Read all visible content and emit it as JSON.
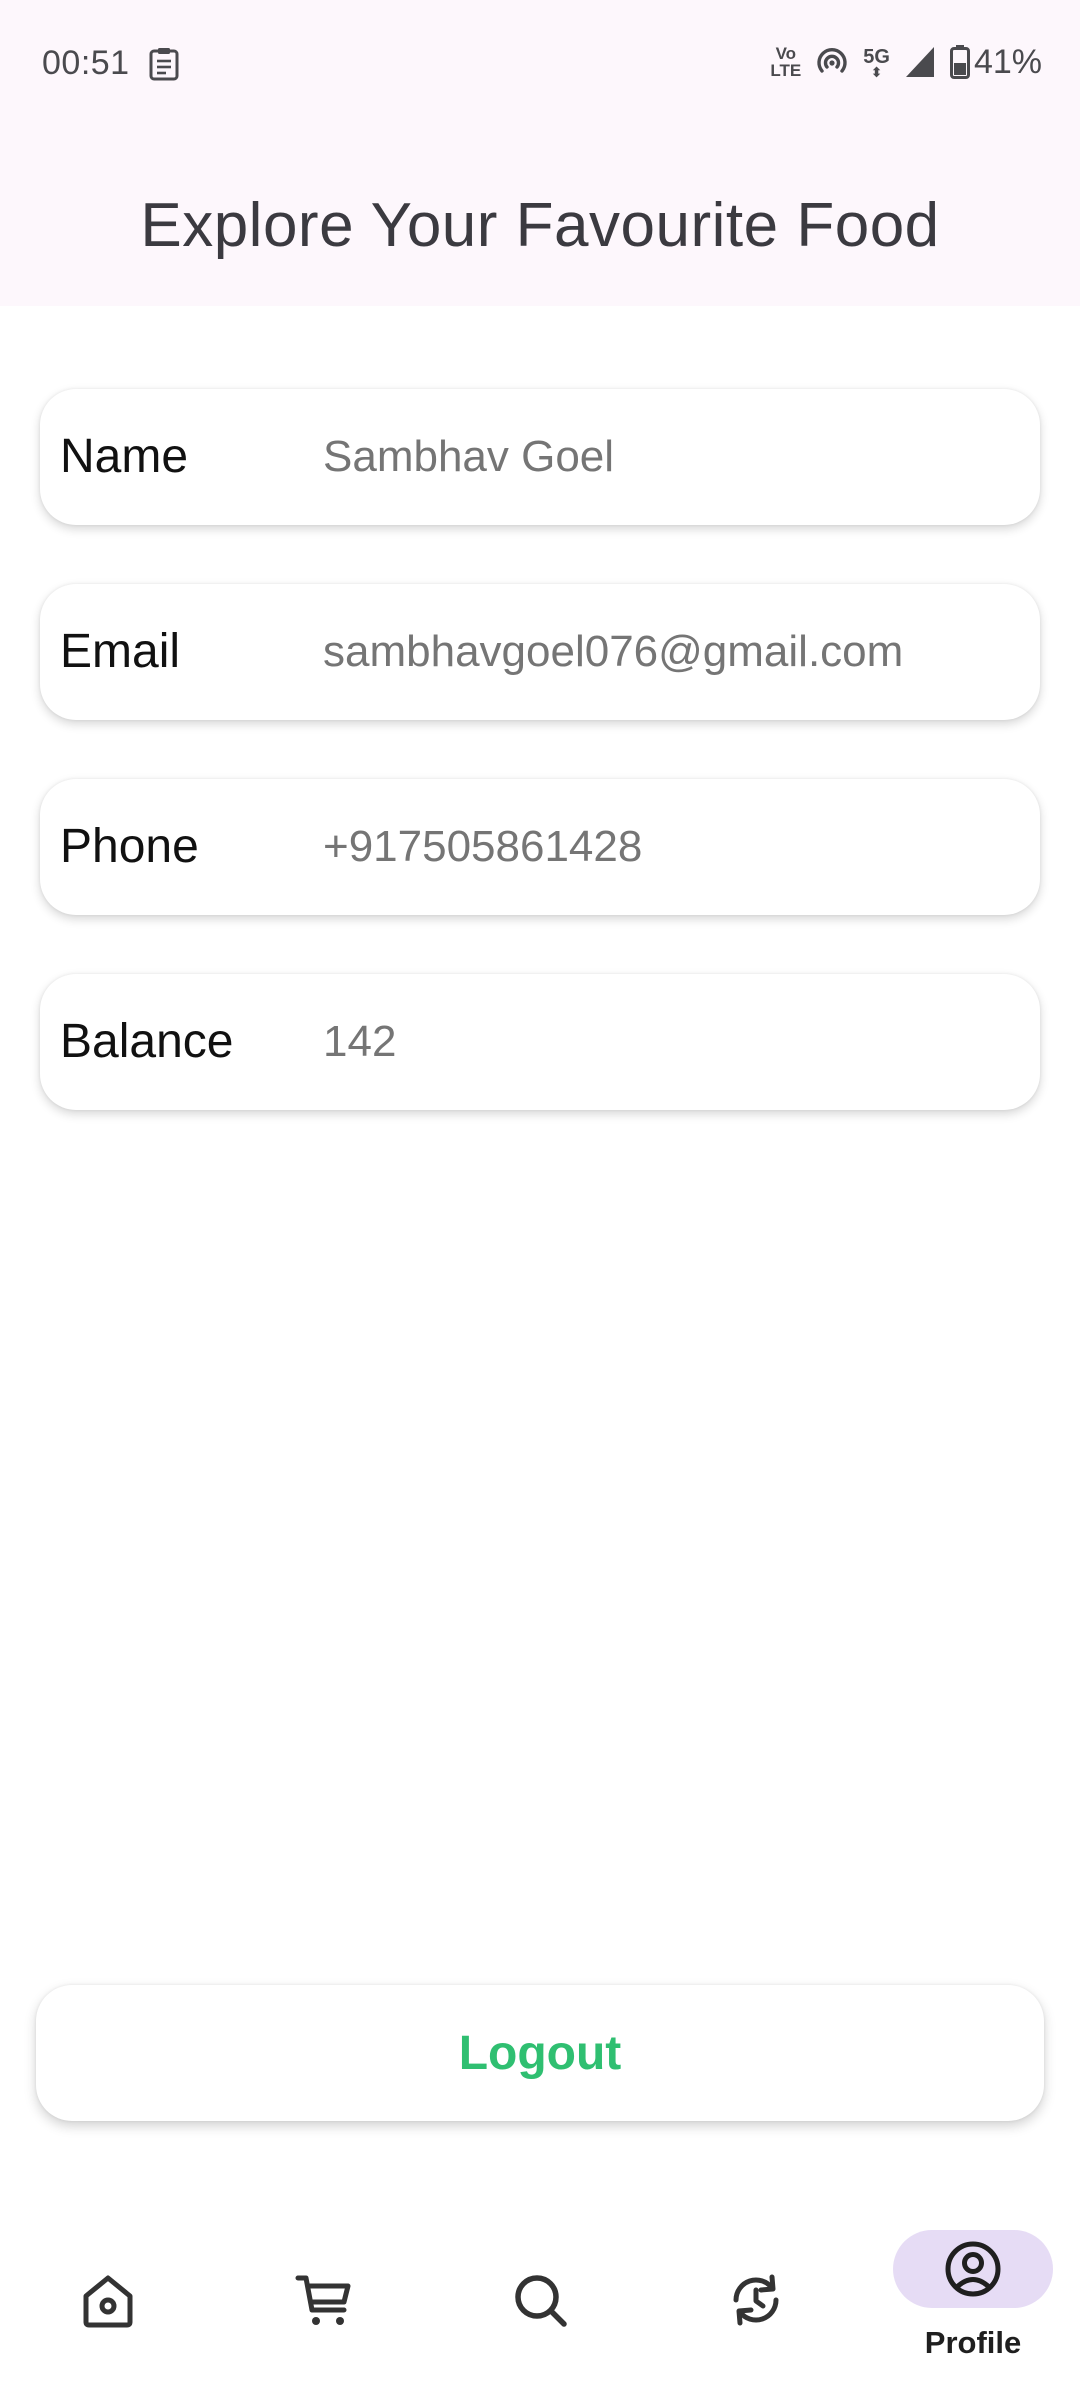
{
  "status_bar": {
    "time": "00:51",
    "volte": [
      "Vo",
      "LTE"
    ],
    "network": "5G",
    "battery": "41%",
    "icons": [
      "clipboard-icon",
      "volte-icon",
      "hotspot-icon",
      "5g-icon",
      "signal-icon",
      "battery-icon"
    ]
  },
  "header": {
    "title": "Explore Your Favourite Food"
  },
  "profile": {
    "fields": [
      {
        "label": "Name",
        "value": "Sambhav Goel"
      },
      {
        "label": "Email",
        "value": "sambhavgoel076@gmail.com"
      },
      {
        "label": "Phone",
        "value": "+917505861428"
      },
      {
        "label": "Balance",
        "value": "142"
      }
    ]
  },
  "logout": {
    "label": "Logout",
    "color": "#2fbf71"
  },
  "bottom_nav": {
    "items": [
      {
        "icon": "home-icon"
      },
      {
        "icon": "cart-icon"
      },
      {
        "icon": "search-icon"
      },
      {
        "icon": "history-icon"
      },
      {
        "icon": "profile-icon",
        "label": "Profile",
        "selected": true
      }
    ],
    "selected_pill_color": "#e6dcf5"
  }
}
